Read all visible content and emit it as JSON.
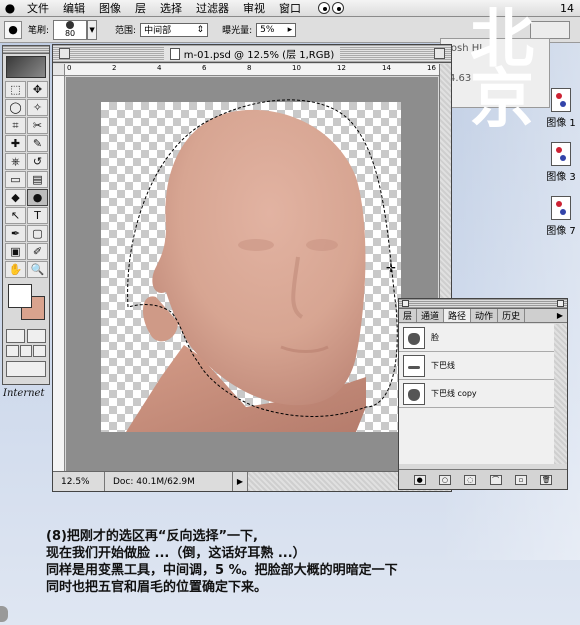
{
  "menubar": {
    "apple": "",
    "items": [
      "文件",
      "编辑",
      "图像",
      "层",
      "选择",
      "过滤器",
      "审视",
      "窗口"
    ],
    "clock": "14"
  },
  "options_bar": {
    "brush_label": "笔刷:",
    "brush_size": "80",
    "range_label": "范围:",
    "range_value": "中间部",
    "exposure_label": "曝光量:",
    "exposure_value": "5%"
  },
  "overlay_title": "北京",
  "bg_window": {
    "text1": "tosh HI",
    "text2": "4.63"
  },
  "desktop_icons": [
    {
      "label": "图像 1"
    },
    {
      "label": "图像 3"
    },
    {
      "label": "图像 7"
    }
  ],
  "tools": {
    "icons": [
      "marquee-icon",
      "move-icon",
      "lasso-icon",
      "magic-wand-icon",
      "crop-icon",
      "slice-icon",
      "heal-icon",
      "brush-icon",
      "stamp-icon",
      "history-brush-icon",
      "eraser-icon",
      "gradient-icon",
      "blur-icon",
      "dodge-icon",
      "path-select-icon",
      "type-icon",
      "pen-icon",
      "shape-icon",
      "notes-icon",
      "eyedropper-icon",
      "hand-icon",
      "zoom-icon"
    ],
    "glyphs": [
      "⬚",
      "✥",
      "◯",
      "✧",
      "⌗",
      "✂",
      "✚",
      "✎",
      "⎈",
      "↺",
      "▭",
      "▤",
      "◆",
      "●",
      "↖",
      "T",
      "✒",
      "▢",
      "▣",
      "✐",
      "✋",
      "🔍"
    ],
    "selected_index": 13,
    "foreground_color": "#ffffff",
    "background_color": "#d9a38e"
  },
  "internet_label": "Internet",
  "document": {
    "title": "m-01.psd @ 12.5% (层 1,RGB)",
    "ruler_top": [
      "0",
      "2",
      "4",
      "6",
      "8",
      "10",
      "12",
      "14",
      "16"
    ],
    "zoom": "12.5%",
    "doc_size": "Doc: 40.1M/62.9M"
  },
  "paths_palette": {
    "tabs": [
      "层",
      "通道",
      "路径",
      "动作",
      "历史"
    ],
    "active_tab": 2,
    "rows": [
      {
        "name": "脸"
      },
      {
        "name": "下巴线"
      },
      {
        "name": "下巴线 copy"
      }
    ]
  },
  "caption": {
    "line1": "(8)把刚才的选区再“反向选择”一下,",
    "line2": "现在我们开始做脸 ...（倒，这话好耳熟 ...）",
    "line3": "同样是用变黑工具，中间调，5 %。把脸部大概的明暗定一下",
    "line4": "同时也把五官和眉毛的位置确定下来。"
  },
  "colors": {
    "skin": "#dba895",
    "skin_shadow": "#b98171",
    "desktop": "#c9d6ea"
  }
}
